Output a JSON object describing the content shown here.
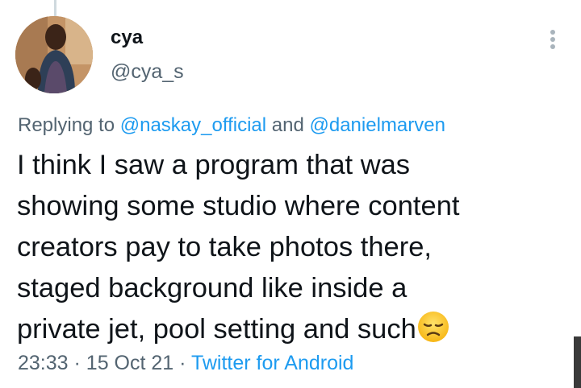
{
  "tweet": {
    "author": {
      "display_name": "cya",
      "handle": "@cya_s"
    },
    "reply": {
      "prefix": "Replying to",
      "mention_1": "@naskay_official",
      "joiner": "and",
      "mention_2": "@danielmarven"
    },
    "text_lines": [
      "I think I saw a program that was",
      "showing some studio where content",
      "creators pay to take photos there,",
      "staged background like inside a",
      "private jet, pool setting and such"
    ],
    "emoji": "disappointed-face-emoji",
    "time": "23:33",
    "date": "15 Oct 21",
    "separator": "·",
    "source": "Twitter for Android"
  },
  "icons": {
    "more": "more-vertical-icon"
  },
  "colors": {
    "text": "#0f1419",
    "secondary": "#536471",
    "link": "#1d9bf0"
  }
}
